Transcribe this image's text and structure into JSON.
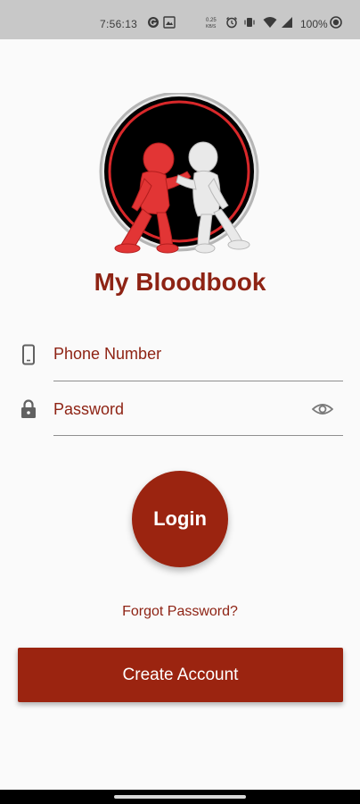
{
  "status_bar": {
    "time": "7:56:13",
    "battery": "100%",
    "icons": [
      "circle-g-icon",
      "photo-icon",
      "data-speed-icon",
      "alarm-icon",
      "vibrate-icon",
      "wifi-icon",
      "signal-icon",
      "battery-icon"
    ]
  },
  "app": {
    "title": "My Bloodbook"
  },
  "form": {
    "phone_placeholder": "Phone Number",
    "password_placeholder": "Password"
  },
  "buttons": {
    "login": "Login",
    "forgot": "Forgot Password?",
    "create": "Create Account"
  },
  "colors": {
    "primary": "#9b2410",
    "text_primary": "#8e2314",
    "background": "#fafafa",
    "status_bar": "#c8c8c8"
  }
}
